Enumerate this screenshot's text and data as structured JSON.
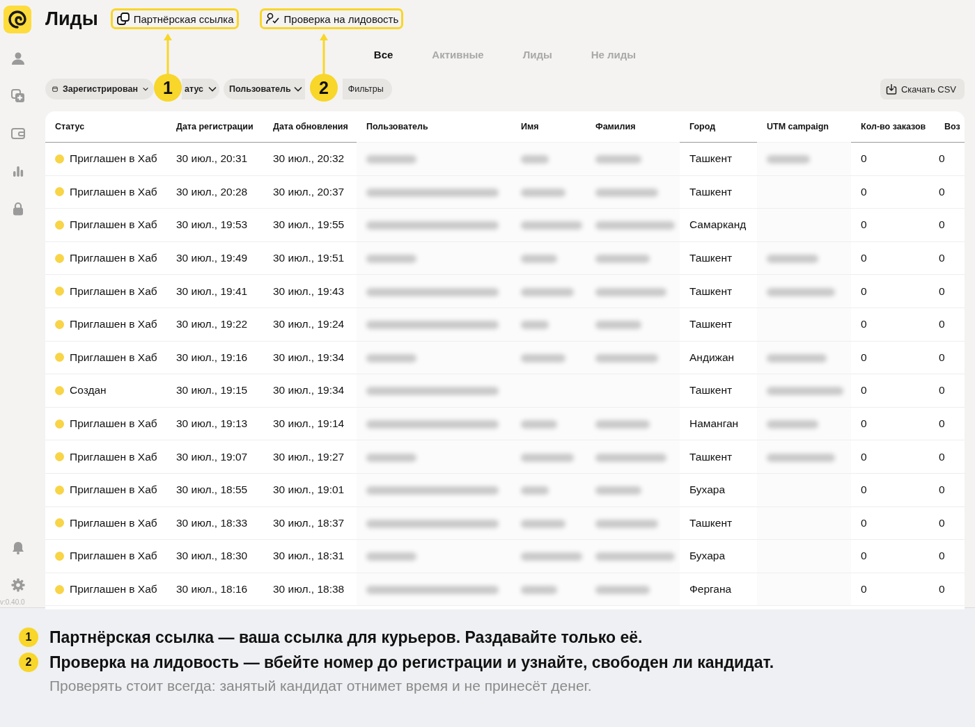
{
  "page_title": "Лиды",
  "header_buttons": [
    {
      "kind": "link",
      "label": "Партнёрская ссылка",
      "highlighted": true
    },
    {
      "kind": "check",
      "label": "Проверка на лидовость",
      "highlighted": true
    }
  ],
  "tabs": [
    {
      "label": "Все",
      "selected": true
    },
    {
      "label": "Активные",
      "selected": false
    },
    {
      "label": "Лиды",
      "selected": false
    },
    {
      "label": "Не лиды",
      "selected": false
    }
  ],
  "filters": [
    {
      "kind": "date",
      "label": "Зарегистрирован"
    },
    {
      "kind": "dropdown",
      "label": "атус"
    },
    {
      "kind": "dropdown",
      "label": "Пользователь"
    },
    {
      "kind": "more",
      "label": "Фильтры"
    }
  ],
  "download_button": "Скачать CSV",
  "callouts": [
    {
      "number": "1"
    },
    {
      "number": "2"
    }
  ],
  "table": {
    "columns": [
      "Статус",
      "Дата регистрации",
      "Дата обновления",
      "Пользователь",
      "Имя",
      "Фамилия",
      "Город",
      "UTM campaign",
      "Кол-во заказов",
      "Воз"
    ],
    "rows": [
      {
        "status": "Приглашен в Хаб",
        "color": "#f8d447",
        "registered": "30 июл., 20:31",
        "updated": "30 июл., 20:32",
        "user_hidden": true,
        "name_hidden": true,
        "surname_hidden": true,
        "city": "Ташкент",
        "utm_hidden": true,
        "orders": "0",
        "column_10": "0"
      },
      {
        "status": "Приглашен в Хаб",
        "color": "#f8d447",
        "registered": "30 июл., 20:28",
        "updated": "30 июл., 20:37",
        "user_hidden": true,
        "name_hidden": true,
        "surname_hidden": true,
        "city": "Ташкент",
        "utm_hidden": false,
        "orders": "0",
        "column_10": "0"
      },
      {
        "status": "Приглашен в Хаб",
        "color": "#f8d447",
        "registered": "30 июл., 19:53",
        "updated": "30 июл., 19:55",
        "user_hidden": true,
        "name_hidden": true,
        "surname_hidden": true,
        "city": "Самарканд",
        "utm_hidden": false,
        "orders": "0",
        "column_10": "0"
      },
      {
        "status": "Приглашен в Хаб",
        "color": "#f8d447",
        "registered": "30 июл., 19:49",
        "updated": "30 июл., 19:51",
        "user_hidden": true,
        "name_hidden": true,
        "surname_hidden": true,
        "city": "Ташкент",
        "utm_hidden": true,
        "orders": "0",
        "column_10": "0"
      },
      {
        "status": "Приглашен в Хаб",
        "color": "#f8d447",
        "registered": "30 июл., 19:41",
        "updated": "30 июл., 19:43",
        "user_hidden": true,
        "name_hidden": true,
        "surname_hidden": true,
        "city": "Ташкент",
        "utm_hidden": true,
        "orders": "0",
        "column_10": "0"
      },
      {
        "status": "Приглашен в Хаб",
        "color": "#f8d447",
        "registered": "30 июл., 19:22",
        "updated": "30 июл., 19:24",
        "user_hidden": true,
        "name_hidden": true,
        "surname_hidden": true,
        "city": "Ташкент",
        "utm_hidden": false,
        "orders": "0",
        "column_10": "0"
      },
      {
        "status": "Приглашен в Хаб",
        "color": "#f8d447",
        "registered": "30 июл., 19:16",
        "updated": "30 июл., 19:34",
        "user_hidden": true,
        "name_hidden": true,
        "surname_hidden": true,
        "city": "Андижан",
        "utm_hidden": true,
        "orders": "0",
        "column_10": "0"
      },
      {
        "status": "Создан",
        "color": "#f8d447",
        "registered": "30 июл., 19:15",
        "updated": "30 июл., 19:34",
        "user_hidden": true,
        "name_hidden": false,
        "surname_hidden": false,
        "city": "Ташкент",
        "utm_hidden": true,
        "orders": "0",
        "column_10": "0"
      },
      {
        "status": "Приглашен в Хаб",
        "color": "#f8d447",
        "registered": "30 июл., 19:13",
        "updated": "30 июл., 19:14",
        "user_hidden": true,
        "name_hidden": true,
        "surname_hidden": true,
        "city": "Наманган",
        "utm_hidden": true,
        "orders": "0",
        "column_10": "0"
      },
      {
        "status": "Приглашен в Хаб",
        "color": "#f8d447",
        "registered": "30 июл., 19:07",
        "updated": "30 июл., 19:27",
        "user_hidden": true,
        "name_hidden": true,
        "surname_hidden": true,
        "city": "Ташкент",
        "utm_hidden": true,
        "orders": "0",
        "column_10": "0"
      },
      {
        "status": "Приглашен в Хаб",
        "color": "#f8d447",
        "registered": "30 июл., 18:55",
        "updated": "30 июл., 19:01",
        "user_hidden": true,
        "name_hidden": true,
        "surname_hidden": true,
        "city": "Бухара",
        "utm_hidden": false,
        "orders": "0",
        "column_10": "0"
      },
      {
        "status": "Приглашен в Хаб",
        "color": "#f8d447",
        "registered": "30 июл., 18:33",
        "updated": "30 июл., 18:37",
        "user_hidden": true,
        "name_hidden": true,
        "surname_hidden": true,
        "city": "Ташкент",
        "utm_hidden": false,
        "orders": "0",
        "column_10": "0"
      },
      {
        "status": "Приглашен в Хаб",
        "color": "#f8d447",
        "registered": "30 июл., 18:30",
        "updated": "30 июл., 18:31",
        "user_hidden": true,
        "name_hidden": true,
        "surname_hidden": true,
        "city": "Бухара",
        "utm_hidden": false,
        "orders": "0",
        "column_10": "0"
      },
      {
        "status": "Приглашен в Хаб",
        "color": "#f8d447",
        "registered": "30 июл., 18:16",
        "updated": "30 июл., 18:38",
        "user_hidden": true,
        "name_hidden": true,
        "surname_hidden": true,
        "city": "Фергана",
        "utm_hidden": false,
        "orders": "0",
        "column_10": "0"
      }
    ]
  },
  "version": "v:0.40.0",
  "notes": [
    {
      "number": "1",
      "text": "Партнёрская ссылка — ваша ссылка для курьеров. Раздавайте только её."
    },
    {
      "number": "2",
      "text": "Проверка на лидовость — вбейте номер до регистрации и узнайте, свободен ли кандидат."
    }
  ],
  "note_hint": "Проверять стоит всегда: занятый кандидат отнимет время и не принесёт денег."
}
